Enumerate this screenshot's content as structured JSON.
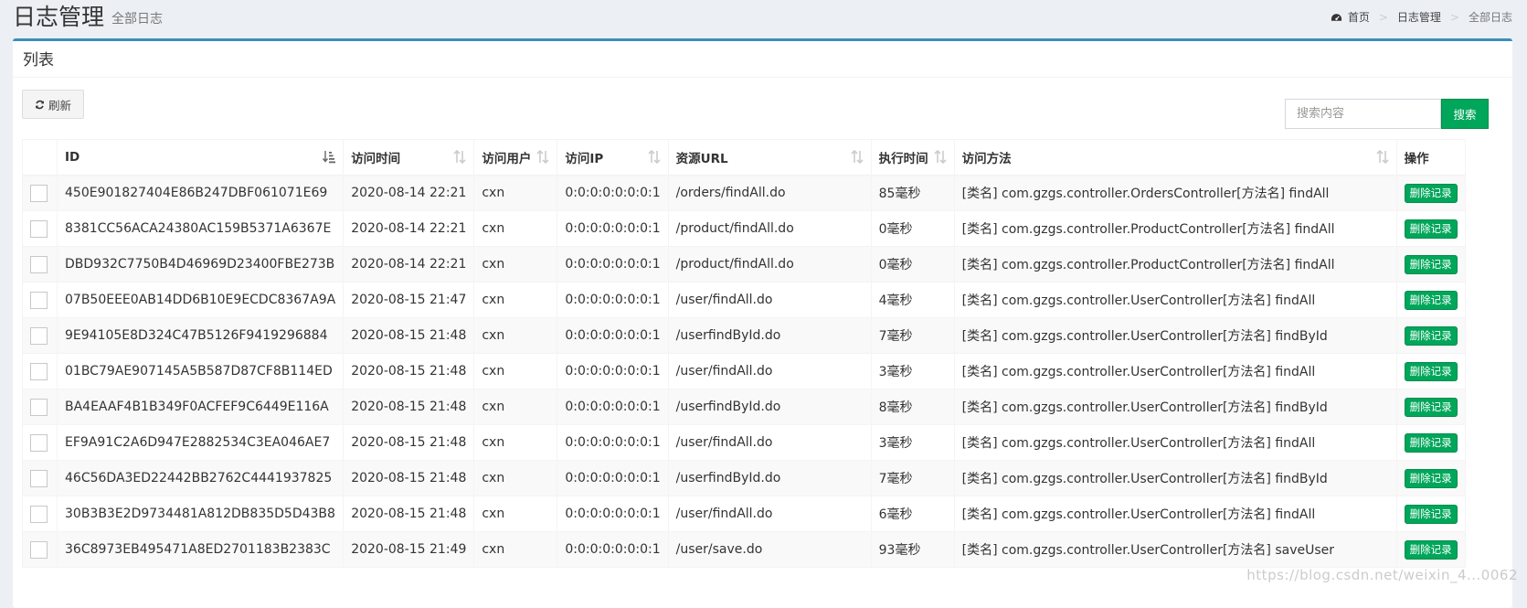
{
  "header": {
    "title": "日志管理",
    "subtitle": "全部日志",
    "breadcrumb": [
      "首页",
      "日志管理",
      "全部日志"
    ]
  },
  "box": {
    "title": "列表",
    "refresh_label": "刷新",
    "search_placeholder": "搜索内容",
    "search_label": "搜索"
  },
  "table": {
    "columns": [
      "ID",
      "访问时间",
      "访问用户",
      "访问IP",
      "资源URL",
      "执行时间",
      "访问方法",
      "操作"
    ],
    "delete_label": "删除记录",
    "rows": [
      {
        "id": "450E901827404E86B247DBF061071E69",
        "time": "2020-08-14 22:21",
        "user": "cxn",
        "ip": "0:0:0:0:0:0:0:1",
        "url": "/orders/findAll.do",
        "duration": "85毫秒",
        "method": "[类名] com.gzgs.controller.OrdersController[方法名] findAll"
      },
      {
        "id": "8381CC56ACA24380AC159B5371A6367E",
        "time": "2020-08-14 22:21",
        "user": "cxn",
        "ip": "0:0:0:0:0:0:0:1",
        "url": "/product/findAll.do",
        "duration": "0毫秒",
        "method": "[类名] com.gzgs.controller.ProductController[方法名] findAll"
      },
      {
        "id": "DBD932C7750B4D46969D23400FBE273B",
        "time": "2020-08-14 22:21",
        "user": "cxn",
        "ip": "0:0:0:0:0:0:0:1",
        "url": "/product/findAll.do",
        "duration": "0毫秒",
        "method": "[类名] com.gzgs.controller.ProductController[方法名] findAll"
      },
      {
        "id": "07B50EEE0AB14DD6B10E9ECDC8367A9A",
        "time": "2020-08-15 21:47",
        "user": "cxn",
        "ip": "0:0:0:0:0:0:0:1",
        "url": "/user/findAll.do",
        "duration": "4毫秒",
        "method": "[类名] com.gzgs.controller.UserController[方法名] findAll"
      },
      {
        "id": "9E94105E8D324C47B5126F9419296884",
        "time": "2020-08-15 21:48",
        "user": "cxn",
        "ip": "0:0:0:0:0:0:0:1",
        "url": "/userfindById.do",
        "duration": "7毫秒",
        "method": "[类名] com.gzgs.controller.UserController[方法名] findById"
      },
      {
        "id": "01BC79AE907145A5B587D87CF8B114ED",
        "time": "2020-08-15 21:48",
        "user": "cxn",
        "ip": "0:0:0:0:0:0:0:1",
        "url": "/user/findAll.do",
        "duration": "3毫秒",
        "method": "[类名] com.gzgs.controller.UserController[方法名] findAll"
      },
      {
        "id": "BA4EAAF4B1B349F0ACFEF9C6449E116A",
        "time": "2020-08-15 21:48",
        "user": "cxn",
        "ip": "0:0:0:0:0:0:0:1",
        "url": "/userfindById.do",
        "duration": "8毫秒",
        "method": "[类名] com.gzgs.controller.UserController[方法名] findById"
      },
      {
        "id": "EF9A91C2A6D947E2882534C3EA046AE7",
        "time": "2020-08-15 21:48",
        "user": "cxn",
        "ip": "0:0:0:0:0:0:0:1",
        "url": "/user/findAll.do",
        "duration": "3毫秒",
        "method": "[类名] com.gzgs.controller.UserController[方法名] findAll"
      },
      {
        "id": "46C56DA3ED22442BB2762C4441937825",
        "time": "2020-08-15 21:48",
        "user": "cxn",
        "ip": "0:0:0:0:0:0:0:1",
        "url": "/userfindById.do",
        "duration": "7毫秒",
        "method": "[类名] com.gzgs.controller.UserController[方法名] findById"
      },
      {
        "id": "30B3B3E2D9734481A812DB835D5D43B8",
        "time": "2020-08-15 21:48",
        "user": "cxn",
        "ip": "0:0:0:0:0:0:0:1",
        "url": "/user/findAll.do",
        "duration": "6毫秒",
        "method": "[类名] com.gzgs.controller.UserController[方法名] findAll"
      },
      {
        "id": "36C8973EB495471A8ED2701183B2383C",
        "time": "2020-08-15 21:49",
        "user": "cxn",
        "ip": "0:0:0:0:0:0:0:1",
        "url": "/user/save.do",
        "duration": "93毫秒",
        "method": "[类名] com.gzgs.controller.UserController[方法名] saveUser"
      }
    ]
  },
  "watermark": "https://blog.csdn.net/weixin_4...0062"
}
